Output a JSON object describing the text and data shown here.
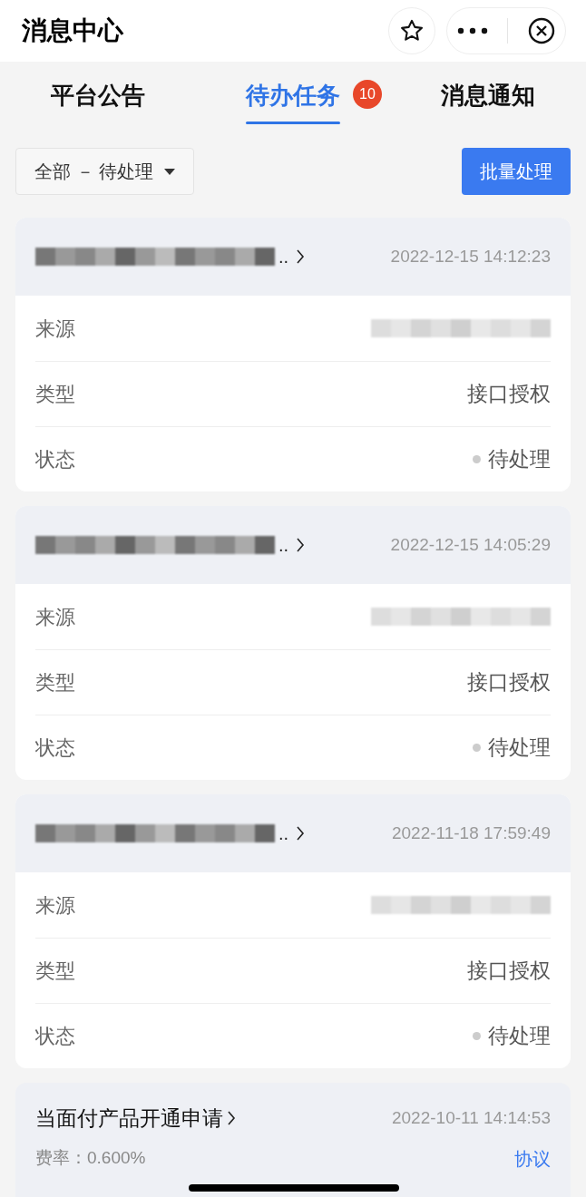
{
  "window": {
    "title": "消息中心"
  },
  "tabs": [
    {
      "label": "平台公告",
      "selected": false
    },
    {
      "label": "待办任务",
      "selected": true,
      "badge": "10"
    },
    {
      "label": "消息通知",
      "selected": false
    }
  ],
  "filter": {
    "value": "全部 － 待处理"
  },
  "batch_button": "批量处理",
  "tasks": [
    {
      "title_visible": "..",
      "time": "2022-12-15 14:12:23",
      "fields": [
        {
          "kind": "redacted",
          "label": "来源"
        },
        {
          "kind": "text",
          "label": "类型",
          "value": "接口授权"
        },
        {
          "kind": "status",
          "label": "状态",
          "value": "待处理",
          "color": "#cccccc"
        }
      ]
    },
    {
      "title_visible": "..",
      "time": "2022-12-15 14:05:29",
      "fields": [
        {
          "kind": "redacted",
          "label": "来源"
        },
        {
          "kind": "text",
          "label": "类型",
          "value": "接口授权"
        },
        {
          "kind": "status",
          "label": "状态",
          "value": "待处理",
          "color": "#cccccc"
        }
      ]
    },
    {
      "title_visible": "..",
      "time": "2022-11-18 17:59:49",
      "fields": [
        {
          "kind": "redacted",
          "label": "来源"
        },
        {
          "kind": "text",
          "label": "类型",
          "value": "接口授权"
        },
        {
          "kind": "status",
          "label": "状态",
          "value": "待处理",
          "color": "#cccccc"
        }
      ]
    }
  ],
  "application": {
    "title": "当面付产品开通申请",
    "time": "2022-10-11 14:14:53",
    "rate": "费率：0.600%",
    "link": "协议"
  }
}
